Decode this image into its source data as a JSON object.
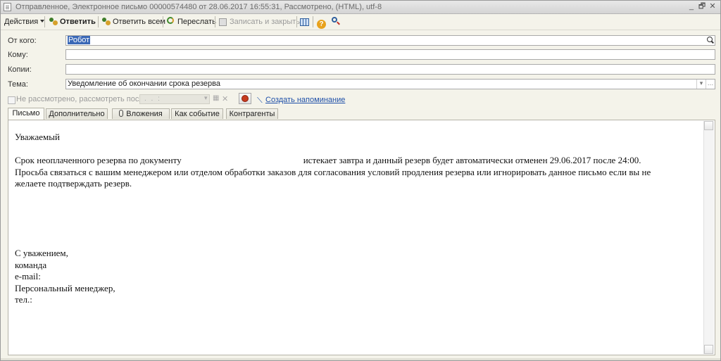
{
  "window": {
    "title": "Отправленное, Электронное письмо 00000574480 от 28.06.2017 16:55:31, Рассмотрено,  (HTML), utf-8",
    "controls": [
      "_",
      "🗗",
      "✕"
    ]
  },
  "toolbar": {
    "actions_label": "Действия",
    "reply_label": "Ответить",
    "reply_all_label": "Ответить всем",
    "forward_label": "Переслать",
    "save_close_label": "Записать и закрыть"
  },
  "form": {
    "from_label": "От кого:",
    "from_value": "Робот",
    "to_label": "Кому:",
    "to_value": "",
    "cc_label": "Копии:",
    "cc_value": "",
    "subject_label": "Тема:",
    "subject_value": "Уведомление об окончании срока резерва"
  },
  "reminder": {
    "checkbox_label": "Не рассмотрено, рассмотреть после:",
    "date_placeholder": ". .    :",
    "create_link": "Создать напоминание"
  },
  "tabs": [
    {
      "label": "Письмо",
      "active": true
    },
    {
      "label": "Дополнительно",
      "active": false
    },
    {
      "label": "Вложения",
      "active": false
    },
    {
      "label": "Как событие",
      "active": false
    },
    {
      "label": "Контрагенты",
      "active": false
    }
  ],
  "letter": {
    "greeting": "Уважаемый",
    "line1_a": "Срок неоплаченного резерва по документу",
    "line1_b": "истекает завтра и данный резерв будет автоматически отменен 29.06.2017 после 24:00.",
    "line2": "Просьба связаться с вашим менеджером или отделом обработки заказов для согласования условий продления резерва или игнорировать данное письмо если вы не",
    "line3": "желаете подтверждать резерв.",
    "sign1": "С уважением,",
    "sign2": "команда",
    "sign3": "e-mail:",
    "sign4": "Персональный менеджер,",
    "sign5": "тел.:"
  }
}
